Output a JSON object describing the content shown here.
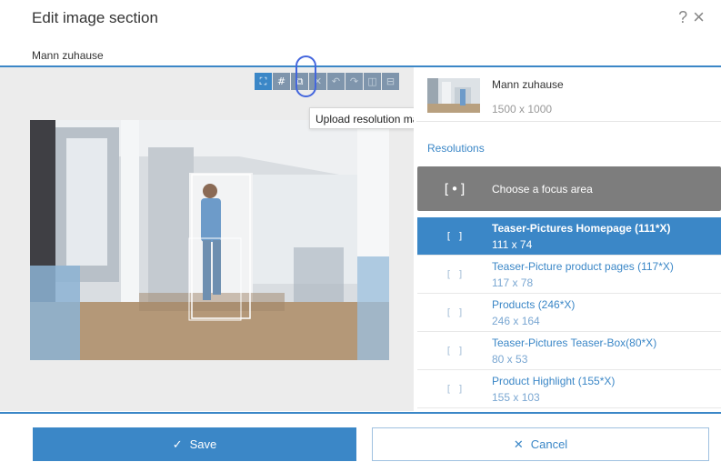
{
  "dialog": {
    "title": "Edit image section",
    "help_icon": "?",
    "close_icon": "×",
    "image_name": "Mann zuhause"
  },
  "toolbar": {
    "buttons": [
      {
        "icon": "focus-area-icon",
        "glyph": "⛶",
        "state": "active"
      },
      {
        "icon": "crop-icon",
        "glyph": "#",
        "state": "selected"
      },
      {
        "icon": "upload-resolution-icon",
        "glyph": "⧉",
        "state": "selected"
      },
      {
        "icon": "close-icon",
        "glyph": "✕",
        "state": "disabled"
      },
      {
        "icon": "undo-icon",
        "glyph": "↶",
        "state": "disabled"
      },
      {
        "icon": "redo-icon",
        "glyph": "↷",
        "state": "disabled"
      },
      {
        "icon": "flip-icon",
        "glyph": "◫",
        "state": "disabled"
      },
      {
        "icon": "delete-icon",
        "glyph": "⊟",
        "state": "disabled"
      }
    ],
    "tooltip": "Upload resolution manually"
  },
  "image_meta": {
    "name": "Mann zuhause",
    "size": "1500 x 1000"
  },
  "resolutions": {
    "label": "Resolutions",
    "focus_button_label": "Choose a focus area",
    "items": [
      {
        "name": "Teaser-Pictures Homepage (111*X)",
        "dims": "111 x 74",
        "active": true
      },
      {
        "name": "Teaser-Picture product pages (117*X)",
        "dims": "117 x 78",
        "active": false
      },
      {
        "name": "Products (246*X)",
        "dims": "246 x 164",
        "active": false
      },
      {
        "name": "Teaser-Pictures Teaser-Box(80*X)",
        "dims": "80 x 53",
        "active": false
      },
      {
        "name": "Product Highlight (155*X)",
        "dims": "155 x 103",
        "active": false
      }
    ]
  },
  "footer": {
    "save_label": "Save",
    "save_icon": "✓",
    "cancel_label": "Cancel",
    "cancel_icon": "✕"
  },
  "colors": {
    "accent": "#3b87c7",
    "focus_button": "#7d7d7d",
    "toolbar_inactive": "#7f95ac"
  }
}
